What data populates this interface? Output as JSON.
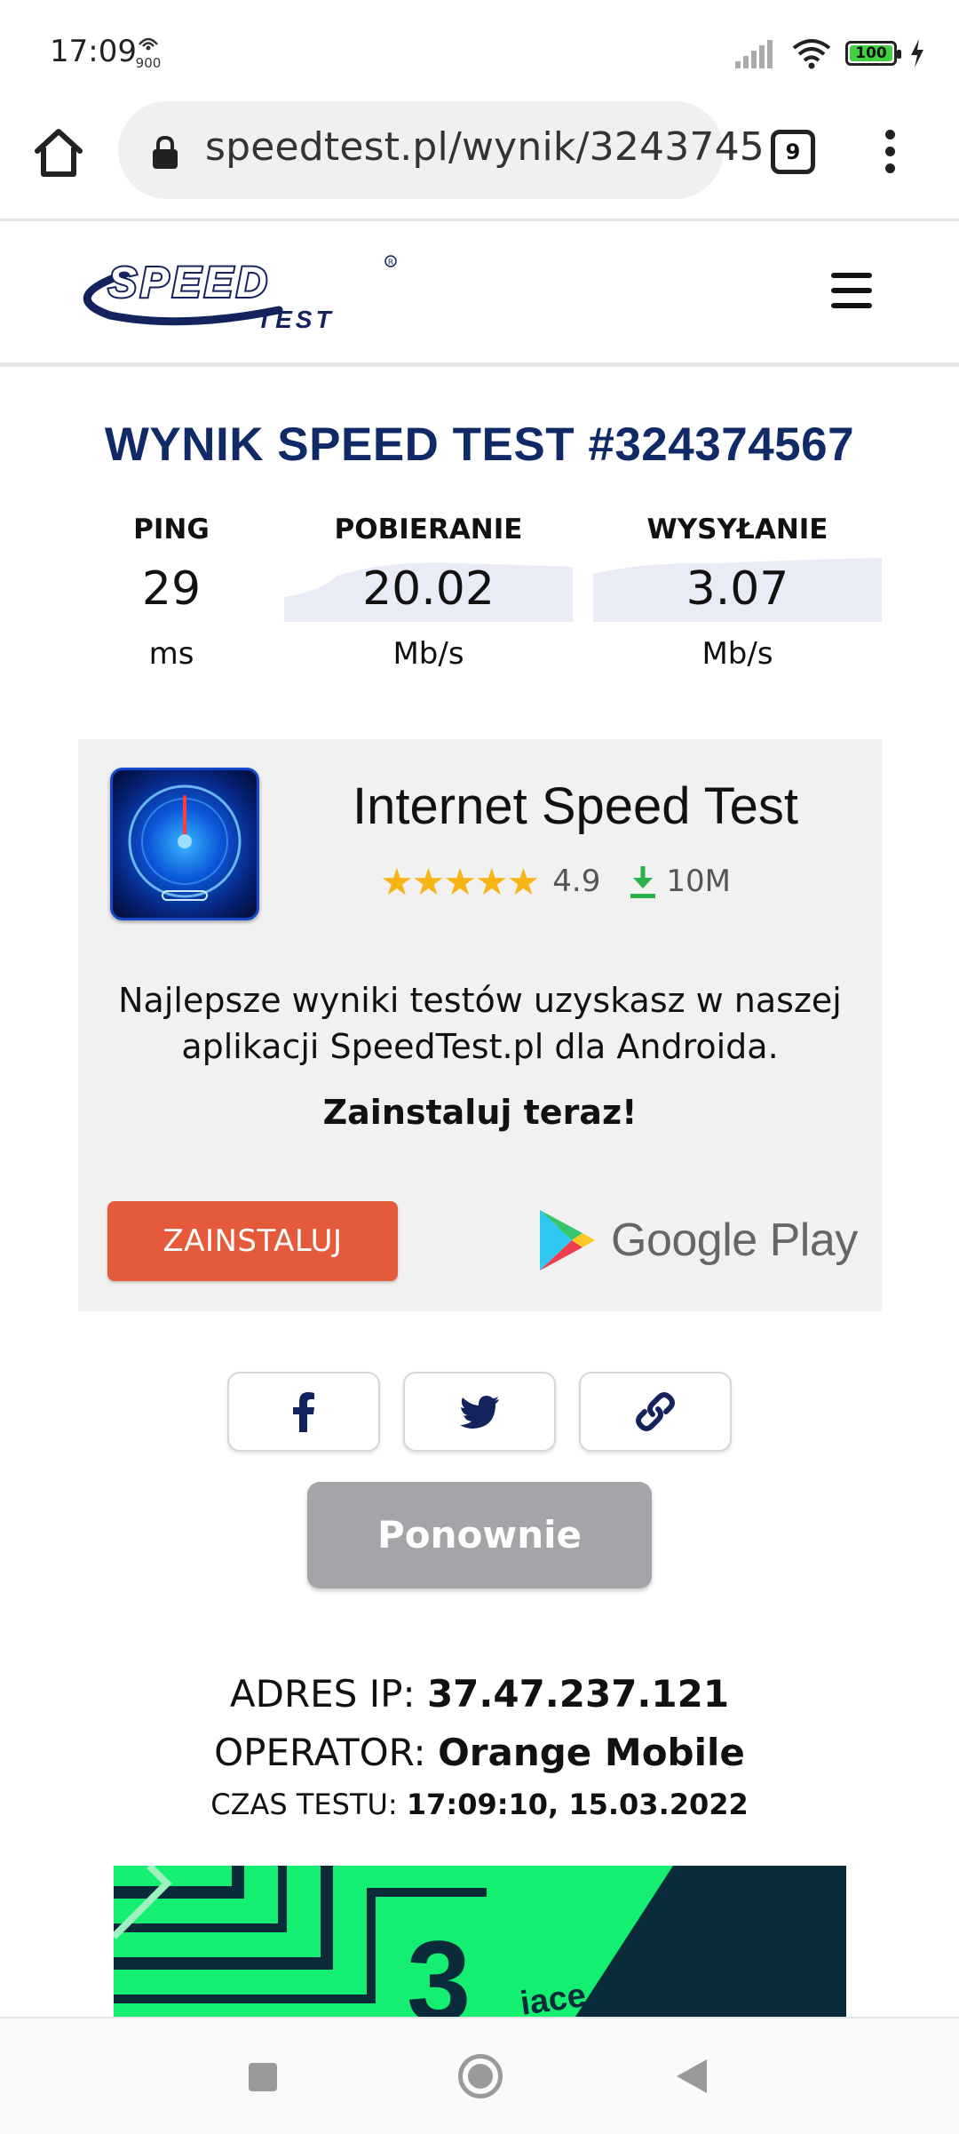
{
  "status_bar": {
    "time": "17:09",
    "badge": "900",
    "battery": "100"
  },
  "browser": {
    "url": "speedtest.pl/wynik/3243745",
    "tab_count": "9"
  },
  "site": {
    "logo_text": "SPEED TEST"
  },
  "result": {
    "title": "WYNIK SPEED TEST #324374567",
    "ping": {
      "label": "PING",
      "value": "29",
      "unit": "ms"
    },
    "download": {
      "label": "POBIERANIE",
      "value": "20.02",
      "unit": "Mb/s"
    },
    "upload": {
      "label": "WYSYŁANIE",
      "value": "3.07",
      "unit": "Mb/s"
    }
  },
  "promo": {
    "app_name": "Internet Speed Test",
    "stars": "★★★★★",
    "rating": "4.9",
    "downloads": "10M",
    "text": "Najlepsze wyniki testów uzyskasz w naszej aplikacji SpeedTest.pl dla Androida.",
    "cta": "Zainstaluj teraz!",
    "install_label": "ZAINSTALUJ",
    "store_label": "Google Play"
  },
  "share": {
    "again_label": "Ponownie"
  },
  "info": {
    "ip_label": "ADRES IP:",
    "ip_value": "37.47.237.121",
    "operator_label": "OPERATOR:",
    "operator_value": "Orange Mobile",
    "time_label": "CZAS TESTU:",
    "time_value": "17:09:10, 15.03.2022"
  },
  "ad": {
    "partial_text": "iace"
  },
  "colors": {
    "title": "#0f2a66",
    "install_button": "#e45a3a",
    "again_button": "#a4a4a9",
    "stars": "#f7b515"
  }
}
